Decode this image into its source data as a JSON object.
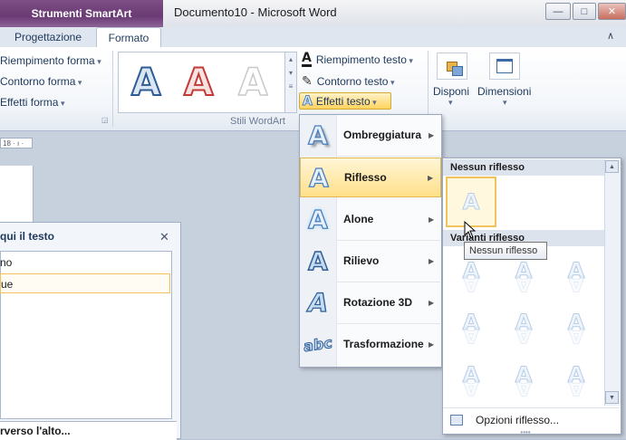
{
  "titlebar": {
    "context_header": "Strumenti SmartArt",
    "document_title": "Documento10  -  Microsoft Word"
  },
  "tabs": [
    {
      "label": "Progettazione",
      "active": false
    },
    {
      "label": "Formato",
      "active": true
    }
  ],
  "ribbon": {
    "shape_styles": {
      "fill": "Riempimento forma",
      "outline": "Contorno forma",
      "effects": "Effetti forma"
    },
    "wordart": {
      "group_label": "Stili WordArt",
      "text_fill": "Riempimento testo",
      "text_outline": "Contorno testo",
      "text_effects": "Effetti testo",
      "gallery_letters": [
        "A",
        "A",
        "A"
      ]
    },
    "arrange_label": "Disponi",
    "size_label": "Dimensioni"
  },
  "ruler_text": "18 · ı ·",
  "text_pane": {
    "title": "qui il testo",
    "lines": [
      "no",
      "ue"
    ],
    "footer": "rverso l'alto..."
  },
  "effects_menu": [
    {
      "label": "Ombreggiatura",
      "icon": "shadow-a-icon",
      "highlighted": false
    },
    {
      "label": "Riflesso",
      "icon": "reflection-a-icon",
      "highlighted": true
    },
    {
      "label": "Alone",
      "icon": "glow-a-icon",
      "highlighted": false
    },
    {
      "label": "Rilievo",
      "icon": "bevel-a-icon",
      "highlighted": false
    },
    {
      "label": "Rotazione 3D",
      "icon": "rotation-3d-a-icon",
      "highlighted": false
    },
    {
      "label": "Trasformazione",
      "icon": "transform-abc-icon",
      "highlighted": false
    }
  ],
  "reflection_submenu": {
    "no_reflection_header": "Nessun riflesso",
    "variants_header": "Varianti riflesso",
    "tooltip": "Nessun riflesso",
    "options_link": "Opzioni riflesso...",
    "glyph": "A"
  },
  "colors": {
    "context_purple": "#6a3a74",
    "highlight_gold": "#ffd35e",
    "wordart_blue": "#2d5c96",
    "wordart_red": "#c23a37"
  }
}
